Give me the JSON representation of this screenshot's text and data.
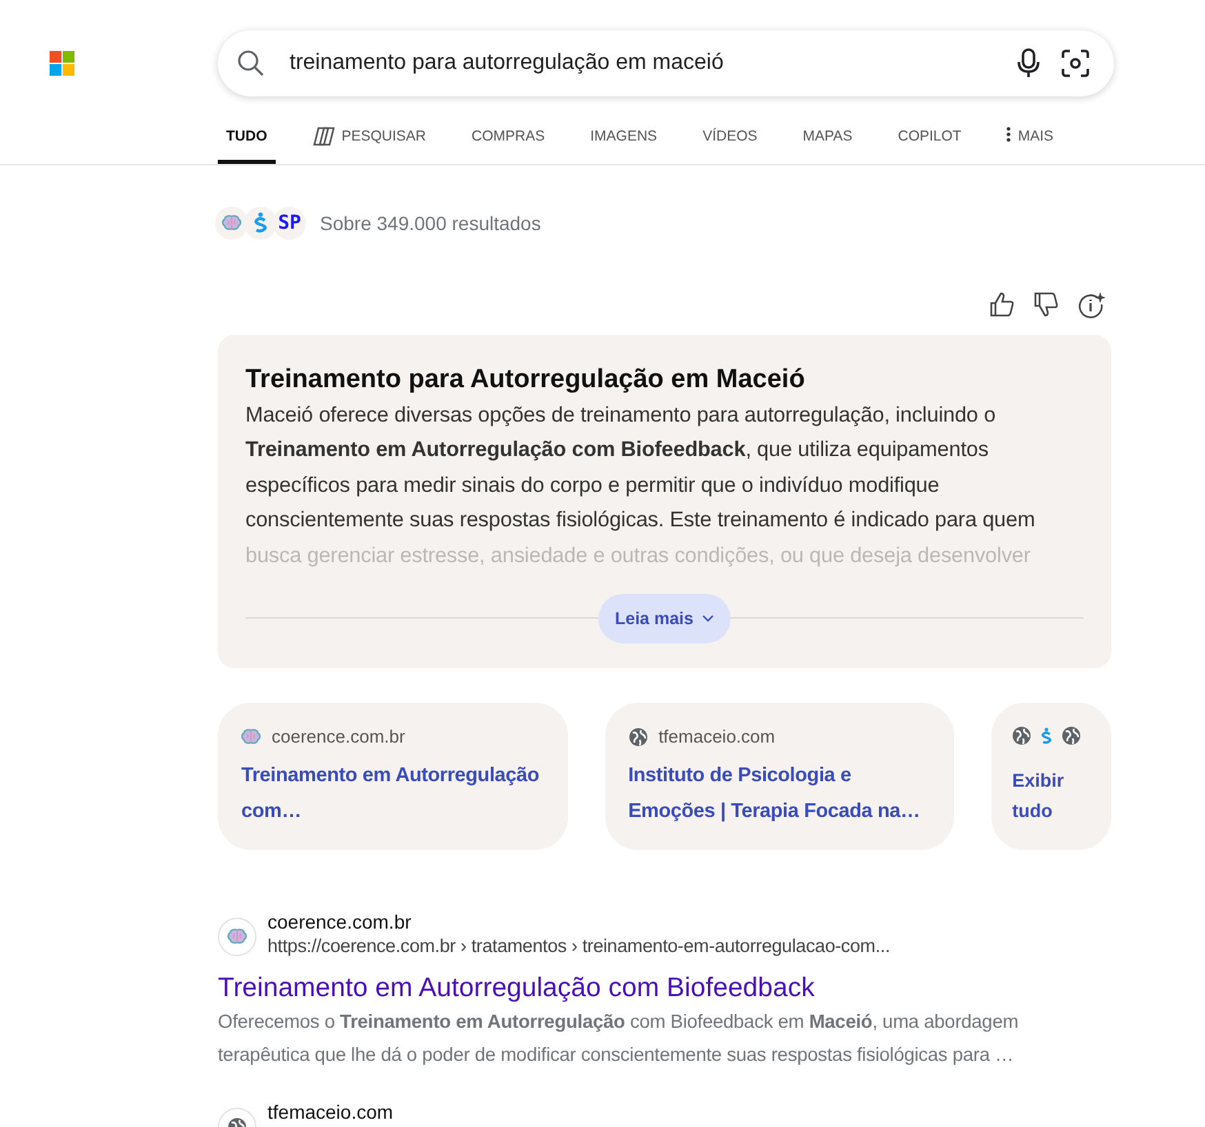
{
  "search": {
    "value": "treinamento para autorregulação em maceió"
  },
  "tabs": [
    {
      "label": "TUDO",
      "selected": true,
      "kind": "plain"
    },
    {
      "label": "PESQUISAR",
      "selected": false,
      "kind": "copilot"
    },
    {
      "label": "COMPRAS",
      "selected": false,
      "kind": "plain"
    },
    {
      "label": "IMAGENS",
      "selected": false,
      "kind": "plain"
    },
    {
      "label": "VÍDEOS",
      "selected": false,
      "kind": "plain"
    },
    {
      "label": "MAPAS",
      "selected": false,
      "kind": "plain"
    },
    {
      "label": "COPILOT",
      "selected": false,
      "kind": "plain"
    },
    {
      "label": "MAIS",
      "selected": false,
      "kind": "more"
    }
  ],
  "summary": {
    "source_icons": [
      {
        "kind": "brain"
      },
      {
        "kind": "dollar"
      },
      {
        "kind": "text",
        "text": "SP"
      }
    ],
    "count": "Sobre 349.000 resultados"
  },
  "answer": {
    "title": "Treinamento para Autorregulação em Maceió",
    "text": "Maceió oferece diversas opções de treinamento para autorregulação, incluindo o **Treinamento em Autorregulação com Biofeedback**, que utiliza equipamentos específicos para medir sinais do corpo e permitir que o indivíduo modifique conscientemente suas respostas fisiológicas. Este treinamento é indicado para quem busca gerenciar estresse, ansiedade e outras condições, ou que deseja desenvolver",
    "more_button": "Leia mais"
  },
  "sources": [
    {
      "kind": "brain",
      "site": "coerence.com.br",
      "title": "Treinamento em Autorregulação com…"
    },
    {
      "kind": "globe",
      "site": "tfemaceio.com",
      "title": "Instituto de Psicologia e Emoções | Terapia Focada na…"
    }
  ],
  "see_all": {
    "label": "Exibir tudo"
  },
  "results": [
    {
      "kind": "brain",
      "site": "coerence.com.br",
      "url": "https://coerence.com.br › tratamentos › treinamento-em-autorregulacao-com...",
      "title": "Treinamento em Autorregulação com Biofeedback",
      "snippet": "Oferecemos o **Treinamento em Autorregulação** com Biofeedback em **Maceió**, uma abordagem terapêutica que lhe dá o poder de modificar conscientemente suas respostas fisiológicas para …"
    },
    {
      "kind": "globe",
      "site": "tfemaceio.com"
    }
  ]
}
